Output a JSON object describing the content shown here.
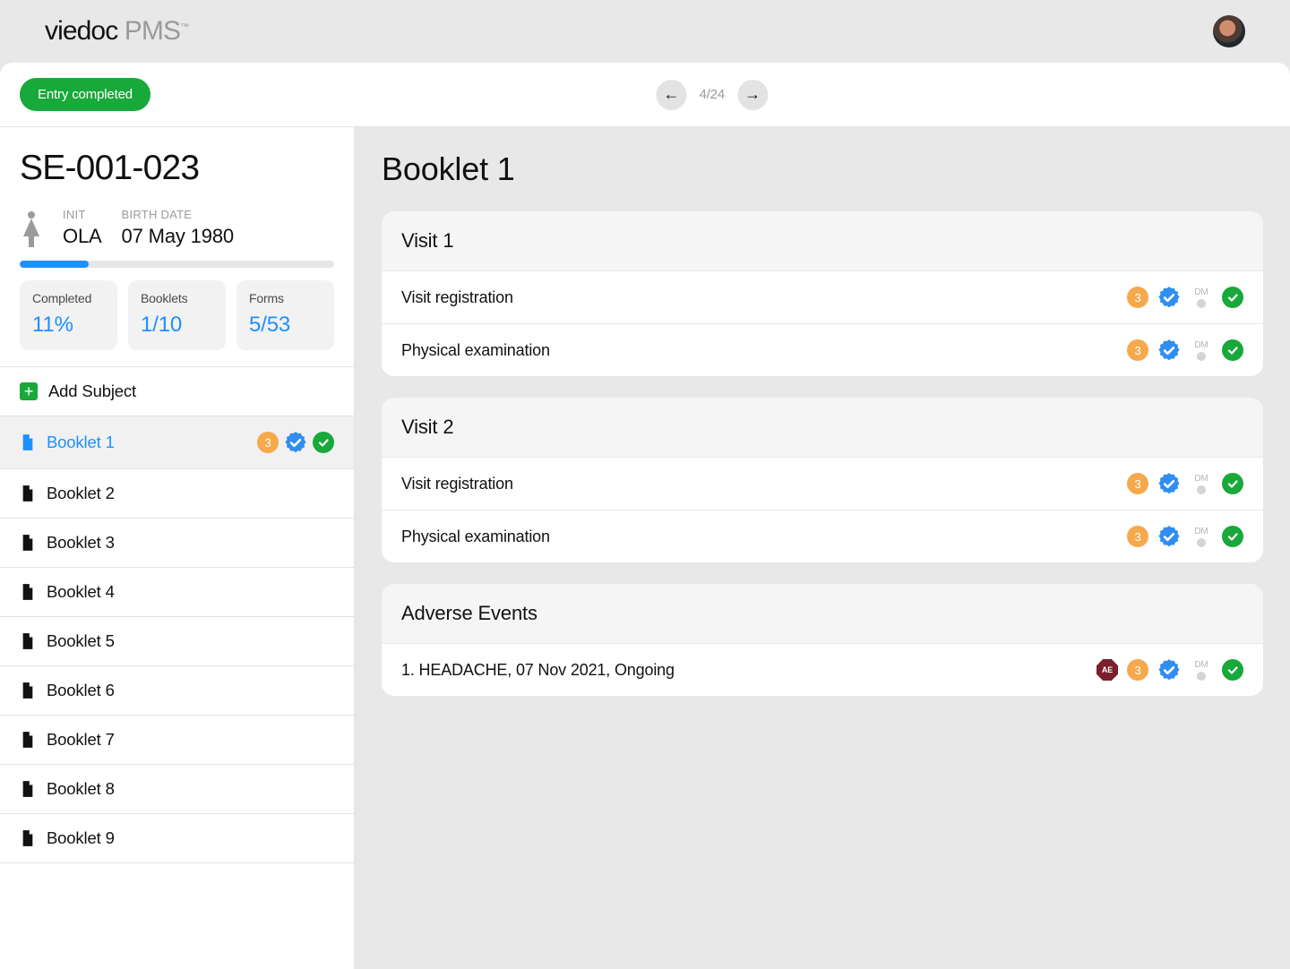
{
  "brand": {
    "name": "viedoc",
    "product": "PMS"
  },
  "header": {
    "entry_chip": "Entry completed",
    "pager": {
      "count": "4/24"
    }
  },
  "subject": {
    "id": "SE-001-023",
    "init_label": "INIT",
    "init_value": "OLA",
    "birth_label": "BIRTH DATE",
    "birth_value": "07 May 1980",
    "progress_pct": 22,
    "stats": {
      "completed_label": "Completed",
      "completed_value": "11%",
      "booklets_label": "Booklets",
      "booklets_value": "1/10",
      "forms_label": "Forms",
      "forms_value": "5/53"
    }
  },
  "sidebar": {
    "add_subject_label": "Add Subject",
    "booklets": [
      {
        "label": "Booklet 1",
        "selected": true,
        "status": {
          "orange": "3",
          "verified": true,
          "done": true
        }
      },
      {
        "label": "Booklet 2"
      },
      {
        "label": "Booklet 3"
      },
      {
        "label": "Booklet 4"
      },
      {
        "label": "Booklet 5"
      },
      {
        "label": "Booklet 6"
      },
      {
        "label": "Booklet 7"
      },
      {
        "label": "Booklet 8"
      },
      {
        "label": "Booklet 9"
      }
    ]
  },
  "main": {
    "title": "Booklet 1",
    "sections": [
      {
        "title": "Visit 1",
        "rows": [
          {
            "label": "Visit registration",
            "orange": "3",
            "dm": "DM"
          },
          {
            "label": "Physical examination",
            "orange": "3",
            "dm": "DM"
          }
        ]
      },
      {
        "title": "Visit 2",
        "rows": [
          {
            "label": "Visit registration",
            "orange": "3",
            "dm": "DM"
          },
          {
            "label": "Physical examination",
            "orange": "3",
            "dm": "DM"
          }
        ]
      },
      {
        "title": "Adverse Events",
        "rows": [
          {
            "label": "1. HEADACHE, 07 Nov 2021, Ongoing",
            "ae": "AE",
            "orange": "3",
            "dm": "DM"
          }
        ]
      }
    ]
  }
}
